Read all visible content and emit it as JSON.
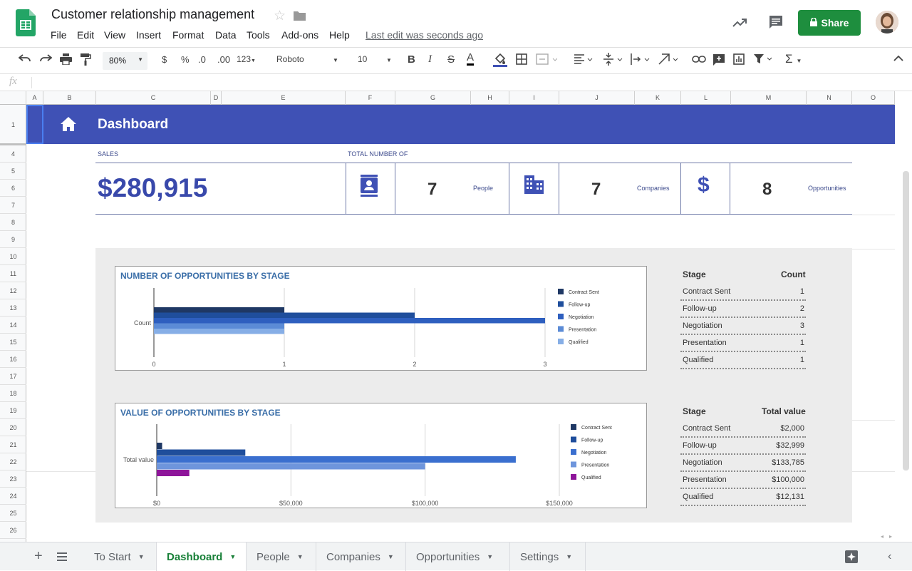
{
  "app": {
    "doc_title": "Customer relationship management",
    "menus": [
      "File",
      "Edit",
      "View",
      "Insert",
      "Format",
      "Data",
      "Tools",
      "Add-ons",
      "Help"
    ],
    "last_edit": "Last edit was seconds ago",
    "share_label": "Share"
  },
  "toolbar": {
    "zoom": "80%",
    "currency": "$",
    "percent": "%",
    "dec_decrease": ".0",
    "dec_increase": ".00",
    "format_more": "123",
    "font": "Roboto",
    "font_size": "10",
    "bold": "B",
    "italic": "I",
    "strike": "S",
    "text_color": "A"
  },
  "formula_bar": {
    "fx": "fx"
  },
  "columns": [
    "A",
    "B",
    "C",
    "D",
    "E",
    "F",
    "G",
    "H",
    "I",
    "J",
    "K",
    "L",
    "M",
    "N",
    "O"
  ],
  "rows": [
    "1",
    "4",
    "5",
    "6",
    "7",
    "8",
    "9",
    "10",
    "11",
    "12",
    "13",
    "14",
    "15",
    "16",
    "17",
    "18",
    "19",
    "20",
    "21",
    "22",
    "23",
    "24",
    "25",
    "26"
  ],
  "dashboard": {
    "title": "Dashboard",
    "sales_label": "SALES",
    "total_label": "TOTAL NUMBER OF",
    "sales_value": "$280,915",
    "people_count": "7",
    "people_label": "People",
    "companies_count": "7",
    "companies_label": "Companies",
    "opportunities_count": "8",
    "opportunities_label": "Opportunities"
  },
  "chart_data": [
    {
      "type": "bar",
      "title": "NUMBER OF OPPORTUNITIES BY STAGE",
      "categories": [
        "Count"
      ],
      "series": [
        {
          "name": "Contract Sent",
          "values": [
            1
          ],
          "color": "#1f3864"
        },
        {
          "name": "Follow-up",
          "values": [
            2
          ],
          "color": "#1f4e9c"
        },
        {
          "name": "Negotiation",
          "values": [
            3
          ],
          "color": "#2e5fbf"
        },
        {
          "name": "Presentation",
          "values": [
            1
          ],
          "color": "#5b8bd6"
        },
        {
          "name": "Qualified",
          "values": [
            1
          ],
          "color": "#86aee6"
        }
      ],
      "xticks": [
        "0",
        "1",
        "2",
        "3"
      ],
      "xlim": [
        0,
        3
      ],
      "legend": "right",
      "orientation": "horizontal"
    },
    {
      "type": "bar",
      "title": "VALUE OF OPPORTUNITIES BY STAGE",
      "categories": [
        "Total value"
      ],
      "series": [
        {
          "name": "Contract Sent",
          "values": [
            2000
          ],
          "color": "#1f3864"
        },
        {
          "name": "Follow-up",
          "values": [
            32999
          ],
          "color": "#1f4e9c"
        },
        {
          "name": "Negotiation",
          "values": [
            133785
          ],
          "color": "#3a6fcf"
        },
        {
          "name": "Presentation",
          "values": [
            100000
          ],
          "color": "#6e95dc"
        },
        {
          "name": "Qualified",
          "values": [
            12131
          ],
          "color": "#8e159a"
        }
      ],
      "xticks": [
        "$0",
        "$50,000",
        "$100,000",
        "$150,000"
      ],
      "xlim": [
        0,
        150000
      ],
      "legend": "right",
      "orientation": "horizontal"
    }
  ],
  "count_table": {
    "header_stage": "Stage",
    "header_value": "Count",
    "rows": [
      {
        "stage": "Contract Sent",
        "value": "1"
      },
      {
        "stage": "Follow-up",
        "value": "2"
      },
      {
        "stage": "Negotiation",
        "value": "3"
      },
      {
        "stage": "Presentation",
        "value": "1"
      },
      {
        "stage": "Qualified",
        "value": "1"
      }
    ]
  },
  "value_table": {
    "header_stage": "Stage",
    "header_value": "Total value",
    "rows": [
      {
        "stage": "Contract Sent",
        "value": "$2,000"
      },
      {
        "stage": "Follow-up",
        "value": "$32,999"
      },
      {
        "stage": "Negotiation",
        "value": "$133,785"
      },
      {
        "stage": "Presentation",
        "value": "$100,000"
      },
      {
        "stage": "Qualified",
        "value": "$12,131"
      }
    ]
  },
  "sheet_tabs": [
    "To Start",
    "Dashboard",
    "People",
    "Companies",
    "Opportunities",
    "Settings"
  ],
  "active_tab": "Dashboard"
}
